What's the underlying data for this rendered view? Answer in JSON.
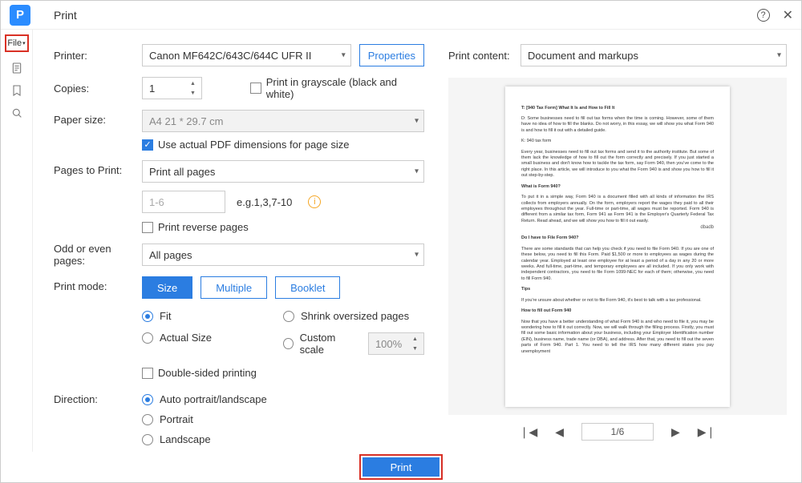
{
  "title": "Print",
  "file_menu": "File",
  "printer": {
    "label": "Printer:",
    "value": "Canon MF642C/643C/644C UFR II",
    "properties_btn": "Properties"
  },
  "copies": {
    "label": "Copies:",
    "value": "1",
    "grayscale": "Print in grayscale (black and white)"
  },
  "paper_size": {
    "label": "Paper size:",
    "value": "A4 21 * 29.7 cm",
    "use_actual": "Use actual PDF dimensions for page size"
  },
  "pages_to_print": {
    "label": "Pages to Print:",
    "value": "Print all pages",
    "range_placeholder": "1-6",
    "eg": "e.g.1,3,7-10",
    "reverse": "Print reverse pages"
  },
  "odd_even": {
    "label": "Odd or even pages:",
    "value": "All pages"
  },
  "print_mode": {
    "label": "Print mode:",
    "tabs": {
      "size": "Size",
      "multiple": "Multiple",
      "booklet": "Booklet"
    },
    "opts": {
      "fit": "Fit",
      "actual": "Actual Size",
      "shrink": "Shrink oversized pages",
      "custom": "Custom scale",
      "custom_val": "100%"
    },
    "double_sided": "Double-sided printing"
  },
  "direction": {
    "label": "Direction:",
    "auto": "Auto portrait/landscape",
    "portrait": "Portrait",
    "landscape": "Landscape"
  },
  "preview": {
    "label": "Print content:",
    "value": "Document and markups",
    "page_display": "1/6",
    "doc_text": {
      "p1": "T: [940 Tax Form] What It Is and How to Fill It",
      "p2": "D: Some businesses need to fill out tax forms when the time is coming. However, some of them have no idea of how to fill the blanks. Do not worry, in this essay, we will show you what Form 940 is and how to fill it out with a detailed guide.",
      "p3": "K: 940 tax form",
      "p4": "Every year, businesses need to fill out tax forms and send it to the authority institute. But some of them lack the knowledge of how to fill out the form correctly and precisely. If you just started a small business and don't know how to tackle the tax form, say Form 940, then you've come to the right place. In this article, we will introduce to you what the Form 940 is and show you how to fill it out step-by-step.",
      "h1": "What is Form 940?",
      "p5": "To put it in a simple way, Form 940 is a document filled with all kinds of information the IRS collects from employers annually. On the form, employers report the wages they paid to all their employees throughout the year. Full-time or part-time, all wages must be reported. Form 940 is different from a similar tax form, Form 941 as Form 941 is the Employer's Quarterly Federal Tax Return. Read ahead, and we will show you how to fill it out easily.",
      "dbadb": "dbadb",
      "h2": "Do I have to File Form 940?",
      "p6": "There are some standards that can help you check if you need to file Form 940. If you are one of these below, you need to fill this Form. Paid $1,500 or more to employees as wages during the calendar year. Employed at least one employee for at least a period of a day in any 20 or more weeks. And full-time, part-time, and temporary employees are all included. If you only work with independent contractors, you need to file Form 1099-NEC for each of them; otherwise, you need to fill Form 940.",
      "h3": "Tips",
      "p7": "If you're unsure about whether or not to file Form 940, it's best to talk with a tax professional.",
      "h4": "How to fill out Form 940",
      "p8": "Now that you have a better understanding of what Form 940 is and who need to file it, you may be wondering how to fill it out correctly. Now, we will walk through the filling process. Firstly, you must fill out some basic information about your business, including your Employer Identification number (EIN), business name, trade name (or DBA), and address. After that, you need to fill out the seven parts of Form 940. Part 1. You need to tell the IRS how many different states you pay unemployment"
    }
  },
  "print_button": "Print"
}
